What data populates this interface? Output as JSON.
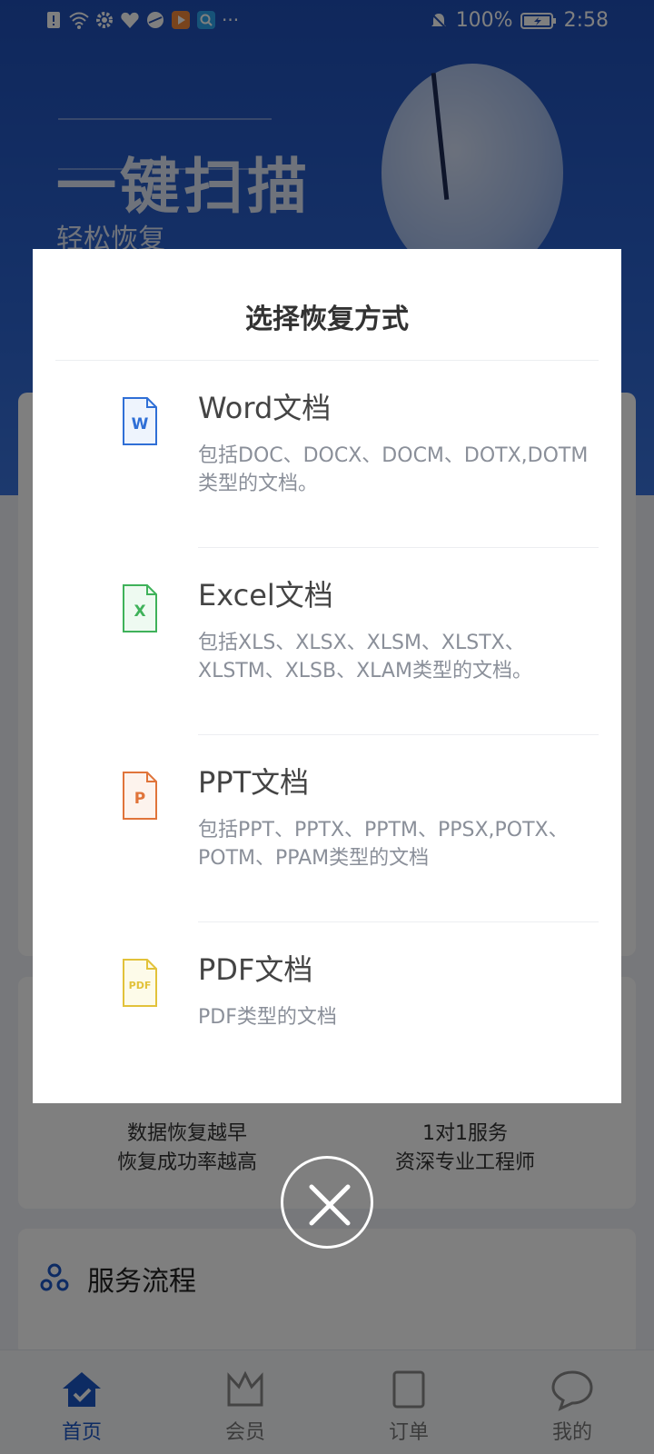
{
  "status_bar": {
    "battery": "100%",
    "time": "2:58",
    "more": "···",
    "icons": [
      "sim-alert-icon",
      "wifi-icon",
      "gear-icon",
      "health-icon",
      "browser-icon",
      "video-icon",
      "search-app-icon",
      "bell-off-icon",
      "battery-icon"
    ]
  },
  "hero": {
    "title": "一键扫描",
    "subtitle": "轻松恢复"
  },
  "features": [
    {
      "line1": "数据恢复越早",
      "line2": "恢复成功率越高"
    },
    {
      "line1": "1对1服务",
      "line2": "资深专业工程师"
    }
  ],
  "service": {
    "title": "服务流程"
  },
  "bottom_nav": [
    {
      "label": "首页",
      "icon": "home-icon",
      "active": true
    },
    {
      "label": "会员",
      "icon": "crown-icon",
      "active": false
    },
    {
      "label": "订单",
      "icon": "order-icon",
      "active": false
    },
    {
      "label": "我的",
      "icon": "chat-bubble-icon",
      "active": false
    }
  ],
  "dialog": {
    "title": "选择恢复方式",
    "options": [
      {
        "title": "Word文档",
        "desc": "包括DOC、DOCX、DOCM、DOTX,DOTM类型的文档。",
        "icon": "word-file-icon",
        "icon_letter": "W",
        "color": "#2f6fd6"
      },
      {
        "title": "Excel文档",
        "desc": "包括XLS、XLSX、XLSM、XLSTX、XLSTM、XLSB、XLAM类型的文档。",
        "icon": "excel-file-icon",
        "icon_letter": "X",
        "color": "#3fb25a"
      },
      {
        "title": "PPT文档",
        "desc": "包括PPT、PPTX、PPTM、PPSX,POTX、POTM、PPAM类型的文档",
        "icon": "ppt-file-icon",
        "icon_letter": "P",
        "color": "#e0743a"
      },
      {
        "title": "PDF文档",
        "desc": "PDF类型的文档",
        "icon": "pdf-file-icon",
        "icon_letter": "PDF",
        "color": "#e2c23a"
      }
    ]
  },
  "colors": {
    "brand_blue": "#1b56c7",
    "overlay": "rgba(0,0,0,0.5)"
  }
}
